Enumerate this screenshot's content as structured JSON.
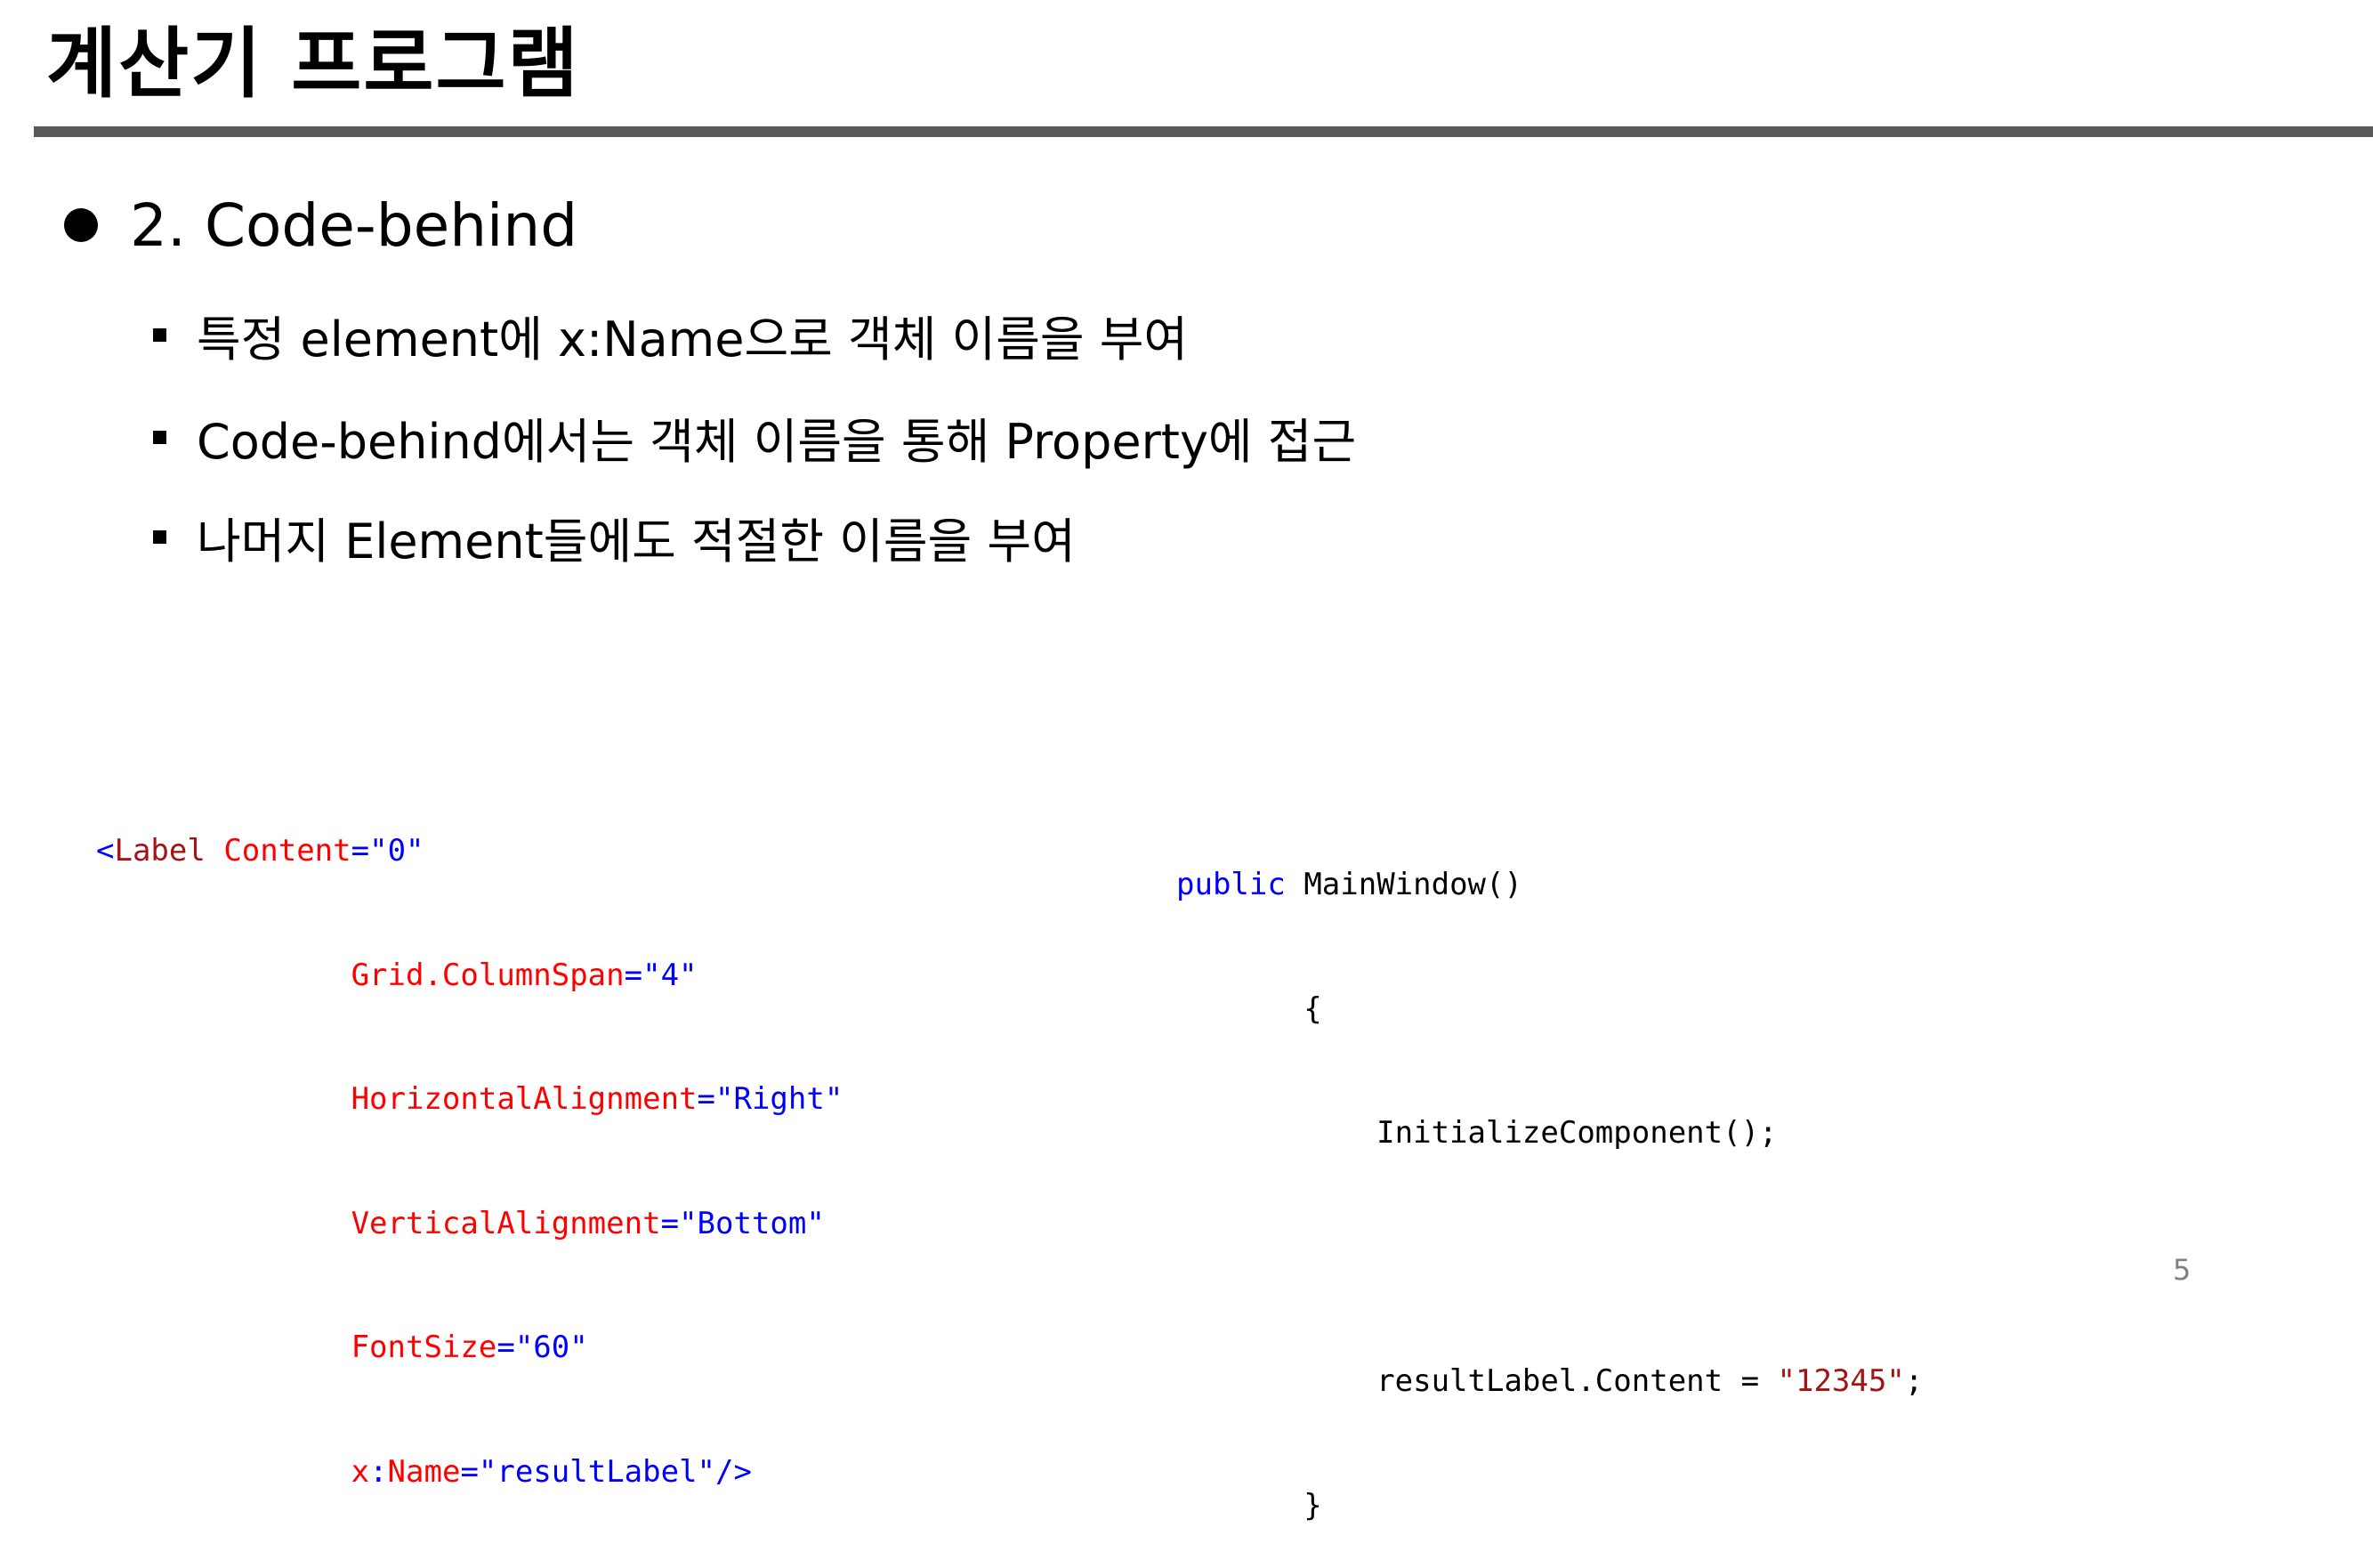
{
  "slide": {
    "title": "계산기 프로그램",
    "page_number": "5"
  },
  "bullet": {
    "text": "2. Code-behind"
  },
  "sub_bullets": [
    "특정 element에 x:Name으로 객체 이름을 부여",
    "Code-behind에서는 객체 이름을 통해 Property에 접근",
    "나머지 Element들에도 적절한 이름을 부여"
  ],
  "xaml_code": {
    "line1": {
      "open": "<",
      "tag": "Label",
      "attr": "Content",
      "eq": "=",
      "value": "\"0\""
    },
    "line2": {
      "attr": "Grid.ColumnSpan",
      "eq": "=",
      "value": "\"4\""
    },
    "line3": {
      "attr": "HorizontalAlignment",
      "eq": "=",
      "value": "\"Right\""
    },
    "line4": {
      "attr": "VerticalAlignment",
      "eq": "=",
      "value": "\"Bottom\""
    },
    "line5": {
      "attr": "FontSize",
      "eq": "=",
      "value": "\"60\""
    },
    "line6": {
      "attr_prefix": "x",
      "colon": ":",
      "attr": "Name",
      "eq": "=",
      "value": "\"resultLabel\"",
      "close": "/>"
    }
  },
  "cs_code": {
    "line1": {
      "keyword": "public",
      "rest": "MainWindow()"
    },
    "line2": "{",
    "line3": "InitializeComponent();",
    "line5": {
      "before": "resultLabel.Content = ",
      "string": "\"12345\"",
      "after": ";"
    },
    "line6": "}"
  },
  "colors": {
    "title_rule": "#595959",
    "xml_tag": "#a31515",
    "xml_attribute": "#ff0000",
    "xml_value": "#0000ff",
    "cs_keyword": "#0000ff",
    "cs_string": "#a31515",
    "page_number": "#7f7f7f"
  }
}
